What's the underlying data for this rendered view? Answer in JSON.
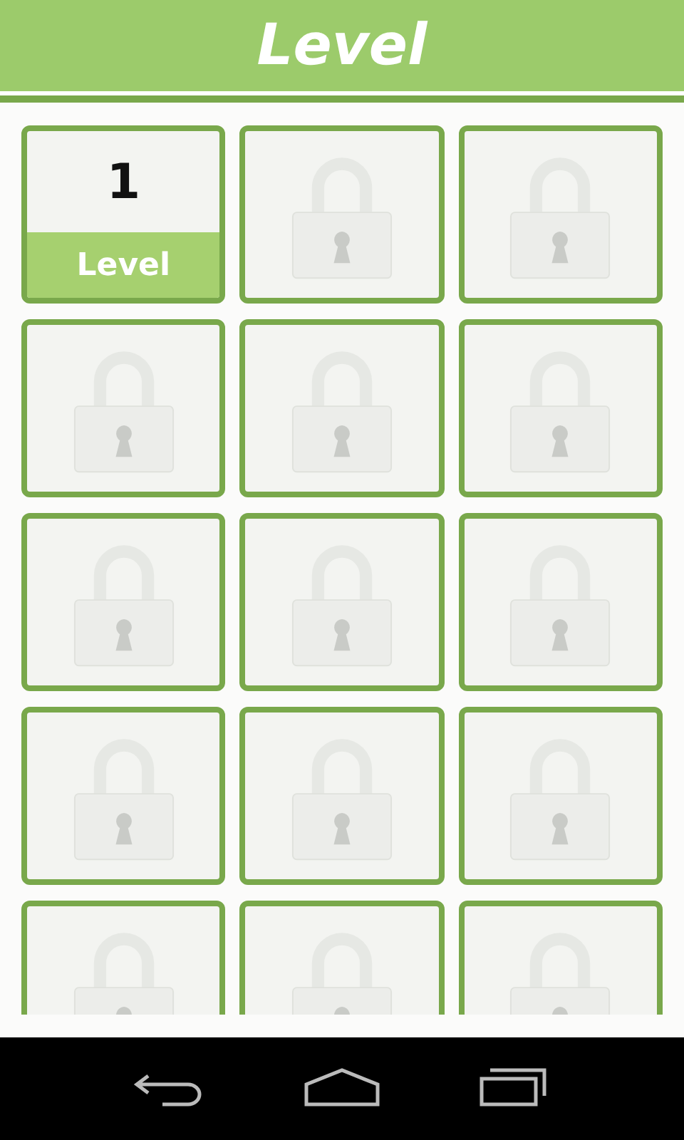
{
  "title": "Level",
  "levels": [
    {
      "locked": false,
      "number": "1",
      "label": "Level"
    },
    {
      "locked": true
    },
    {
      "locked": true
    },
    {
      "locked": true
    },
    {
      "locked": true
    },
    {
      "locked": true
    },
    {
      "locked": true
    },
    {
      "locked": true
    },
    {
      "locked": true
    },
    {
      "locked": true
    },
    {
      "locked": true
    },
    {
      "locked": true
    },
    {
      "locked": true
    },
    {
      "locked": true
    },
    {
      "locked": true
    }
  ]
}
